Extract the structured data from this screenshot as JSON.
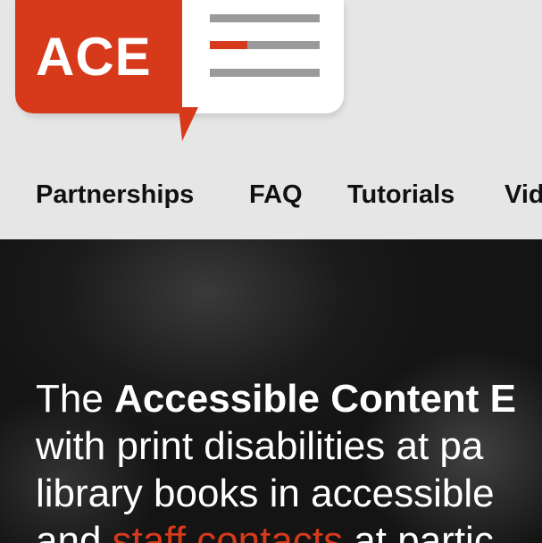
{
  "logo": {
    "text": "ACE",
    "brand_color": "#d7391b",
    "menu_icon": "hamburger-menu-icon"
  },
  "nav": {
    "items": [
      {
        "label": "Partnerships"
      },
      {
        "label": "FAQ"
      },
      {
        "label": "Tutorials"
      },
      {
        "label": "Vid"
      }
    ]
  },
  "hero": {
    "line1_prefix": "The ",
    "line1_strong": "Accessible Content E",
    "line2": "with print disabilities at pa",
    "line3": "library books in accessible",
    "line4_prefix": "and ",
    "line4_link": "staff contacts",
    "line4_suffix": " at partic"
  }
}
